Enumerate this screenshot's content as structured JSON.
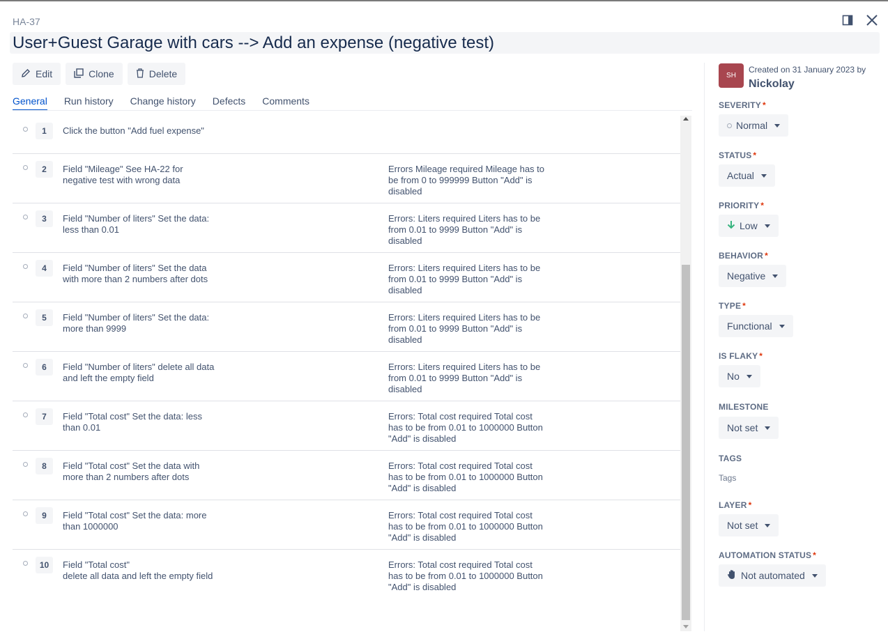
{
  "issue": {
    "key": "HA-37",
    "title": "User+Guest Garage with cars --> Add an expense (negative test)"
  },
  "toolbar": {
    "edit_label": "Edit",
    "clone_label": "Clone",
    "delete_label": "Delete"
  },
  "tabs": [
    {
      "label": "General",
      "active": true
    },
    {
      "label": "Run history",
      "active": false
    },
    {
      "label": "Change history",
      "active": false
    },
    {
      "label": "Defects",
      "active": false
    },
    {
      "label": "Comments",
      "active": false
    }
  ],
  "steps": [
    {
      "number": "1",
      "action": "Click the button \"Add fuel expense\"",
      "expected": ""
    },
    {
      "number": "2",
      "action": "Field \"Mileage\" See HA-22 for negative test with wrong data",
      "expected": "Errors Mileage required Mileage has to be from 0 to 999999 Button \"Add\" is disabled"
    },
    {
      "number": "3",
      "action": "Field \"Number of liters\" Set the data: less than 0.01",
      "expected": "Errors: Liters required Liters has to be from 0.01 to 9999 Button \"Add\" is disabled"
    },
    {
      "number": "4",
      "action": "Field \"Number of liters\" Set the data with more than 2 numbers after dots",
      "expected": "Errors: Liters required Liters has to be from 0.01 to 9999 Button \"Add\" is disabled"
    },
    {
      "number": "5",
      "action": "Field \"Number of liters\" Set the data: more than 9999",
      "expected": "Errors: Liters required Liters has to be from 0.01 to 9999 Button \"Add\" is disabled"
    },
    {
      "number": "6",
      "action": "Field \"Number of liters\" delete all data and left the empty field",
      "expected": "Errors: Liters required Liters has to be from 0.01 to 9999 Button \"Add\" is disabled"
    },
    {
      "number": "7",
      "action": "Field \"Total cost\" Set the data: less than 0.01",
      "expected": "Errors: Total cost required Total cost has to be from 0.01 to 1000000 Button \"Add\" is disabled"
    },
    {
      "number": "8",
      "action": "Field \"Total cost\" Set the data with more than 2 numbers after dots",
      "expected": "Errors: Total cost required Total cost has to be from 0.01 to 1000000 Button \"Add\" is disabled"
    },
    {
      "number": "9",
      "action": "Field \"Total cost\" Set the data: more than 1000000",
      "expected": "Errors: Total cost required Total cost has to be from 0.01 to 1000000 Button \"Add\" is disabled"
    },
    {
      "number": "10",
      "action": "Field \"Total cost\"\ndelete all data and left the empty field",
      "expected": "Errors: Total cost required Total cost has to be from 0.01 to 1000000 Button \"Add\" is disabled"
    }
  ],
  "sidebar": {
    "avatar_initials": "SH",
    "created_text": "Created on 31 January 2023 by",
    "author": "Nickolay",
    "severity": {
      "label": "SEVERITY",
      "value": "Normal"
    },
    "status": {
      "label": "STATUS",
      "value": "Actual"
    },
    "priority": {
      "label": "PRIORITY",
      "value": "Low"
    },
    "behavior": {
      "label": "BEHAVIOR",
      "value": "Negative"
    },
    "type": {
      "label": "TYPE",
      "value": "Functional"
    },
    "is_flaky": {
      "label": "IS FLAKY",
      "value": "No"
    },
    "milestone": {
      "label": "MILESTONE",
      "value": "Not set"
    },
    "tags": {
      "label": "TAGS",
      "placeholder": "Tags"
    },
    "layer": {
      "label": "LAYER",
      "value": "Not set"
    },
    "automation_status": {
      "label": "AUTOMATION STATUS",
      "value": "Not automated"
    }
  },
  "colors": {
    "accent": "#0052cc",
    "required": "#de350b",
    "avatar": "#a8464f",
    "priority_low": "#36b37e"
  }
}
